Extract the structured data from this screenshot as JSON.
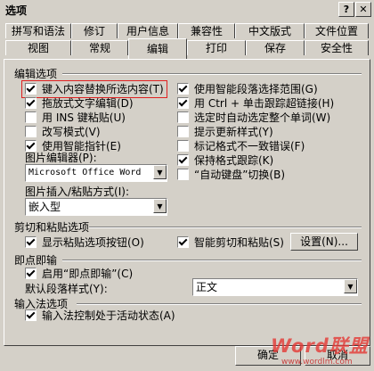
{
  "window": {
    "title": "选项",
    "help": "?",
    "close": "✕"
  },
  "tabs": {
    "row1": [
      "拼写和语法",
      "修订",
      "用户信息",
      "兼容性",
      "中文版式",
      "文件位置"
    ],
    "row2": [
      "视图",
      "常规",
      "编辑",
      "打印",
      "保存",
      "安全性"
    ],
    "active": "编辑"
  },
  "edit_options": {
    "section": "编辑选项",
    "left": [
      {
        "label": "键入内容替换所选内容(T)",
        "checked": true
      },
      {
        "label": "拖放式文字编辑(D)",
        "checked": true
      },
      {
        "label": "用 INS 键粘贴(U)",
        "checked": false
      },
      {
        "label": "改写模式(V)",
        "checked": false
      },
      {
        "label": "使用智能指针(E)",
        "checked": true
      }
    ],
    "right": [
      {
        "label": "使用智能段落选择范围(G)",
        "checked": true
      },
      {
        "label": "用 Ctrl + 单击跟踪超链接(H)",
        "checked": true
      },
      {
        "label": "选定时自动选定整个单词(W)",
        "checked": false
      },
      {
        "label": "提示更新样式(Y)",
        "checked": false
      },
      {
        "label": "标记格式不一致错误(F)",
        "checked": false
      },
      {
        "label": "保持格式跟踪(K)",
        "checked": true
      },
      {
        "label": "“自动键盘”切换(B)",
        "checked": false
      }
    ],
    "picture_editor_label": "图片编辑器(P):",
    "picture_editor_value": "Microsoft Office Word",
    "insert_paste_label": "图片插入/粘贴方式(I):",
    "insert_paste_value": "嵌入型"
  },
  "cut_paste": {
    "section": "剪切和粘贴选项",
    "show_paste_buttons": {
      "label": "显示粘贴选项按钮(O)",
      "checked": true
    },
    "smart_cut": {
      "label": "智能剪切和粘贴(S)",
      "checked": true
    },
    "settings_button": "设置(N)..."
  },
  "click_type": {
    "section": "即点即输",
    "enable": {
      "label": "启用“即点即输”(C)",
      "checked": true
    },
    "default_style_label": "默认段落样式(Y):",
    "default_style_value": "正文"
  },
  "ime": {
    "section": "输入法选项",
    "ime_control": {
      "label": "输入法控制处于活动状态(A)",
      "checked": true
    }
  },
  "footer": {
    "ok": "确定",
    "cancel": "取消"
  },
  "watermark": {
    "brand": "Word联盟",
    "url": "www.wordlm.com",
    "brand_color": "#e53935"
  }
}
